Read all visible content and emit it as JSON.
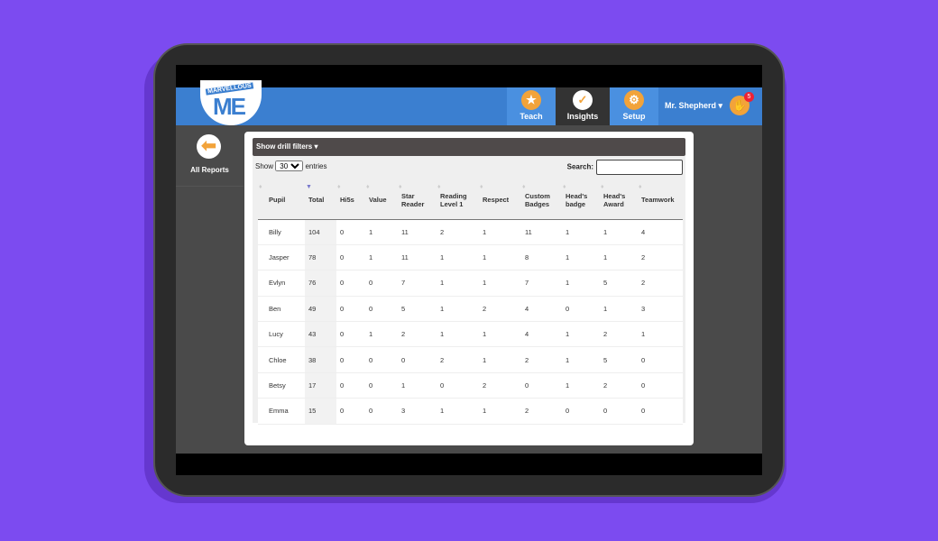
{
  "header": {
    "logo_top": "MARVELLOUS",
    "logo_main": "ME",
    "nav": [
      {
        "label": "Teach",
        "icon": "star-icon",
        "glyph": "★"
      },
      {
        "label": "Insights",
        "icon": "check-icon",
        "glyph": "✓"
      },
      {
        "label": "Setup",
        "icon": "gear-icon",
        "glyph": "⚙"
      }
    ],
    "user": "Mr. Shepherd ▾",
    "notification_count": "5",
    "avatar_glyph": "✋"
  },
  "sidebar": {
    "back_label": "All Reports",
    "back_glyph": "⬅"
  },
  "report": {
    "drill_filters": "Show drill filters ▾",
    "show": "Show",
    "entries_value": "30",
    "entries": "entries",
    "search_label": "Search:",
    "search_value": "",
    "columns": [
      "Pupil",
      "Total",
      "Hi5s",
      "Value",
      "Star Reader",
      "Reading Level 1",
      "Respect",
      "Custom Badges",
      "Head's badge",
      "Head's Award",
      "Teamwork"
    ],
    "rows": [
      [
        "Billy",
        "104",
        "0",
        "1",
        "11",
        "2",
        "1",
        "11",
        "1",
        "1",
        "4"
      ],
      [
        "Jasper",
        "78",
        "0",
        "1",
        "11",
        "1",
        "1",
        "8",
        "1",
        "1",
        "2"
      ],
      [
        "Evlyn",
        "76",
        "0",
        "0",
        "7",
        "1",
        "1",
        "7",
        "1",
        "5",
        "2"
      ],
      [
        "Ben",
        "49",
        "0",
        "0",
        "5",
        "1",
        "2",
        "4",
        "0",
        "1",
        "3"
      ],
      [
        "Lucy",
        "43",
        "0",
        "1",
        "2",
        "1",
        "1",
        "4",
        "1",
        "2",
        "1"
      ],
      [
        "Chloe",
        "38",
        "0",
        "0",
        "0",
        "2",
        "1",
        "2",
        "1",
        "5",
        "0"
      ],
      [
        "Betsy",
        "17",
        "0",
        "0",
        "1",
        "0",
        "2",
        "0",
        "1",
        "2",
        "0"
      ],
      [
        "Emma",
        "15",
        "0",
        "0",
        "3",
        "1",
        "1",
        "2",
        "0",
        "0",
        "0"
      ]
    ]
  },
  "colors": {
    "background": "#7c4bf0",
    "appbar": "#3b7fd0",
    "accent": "#f2a33a",
    "active_tab": "#333333"
  }
}
